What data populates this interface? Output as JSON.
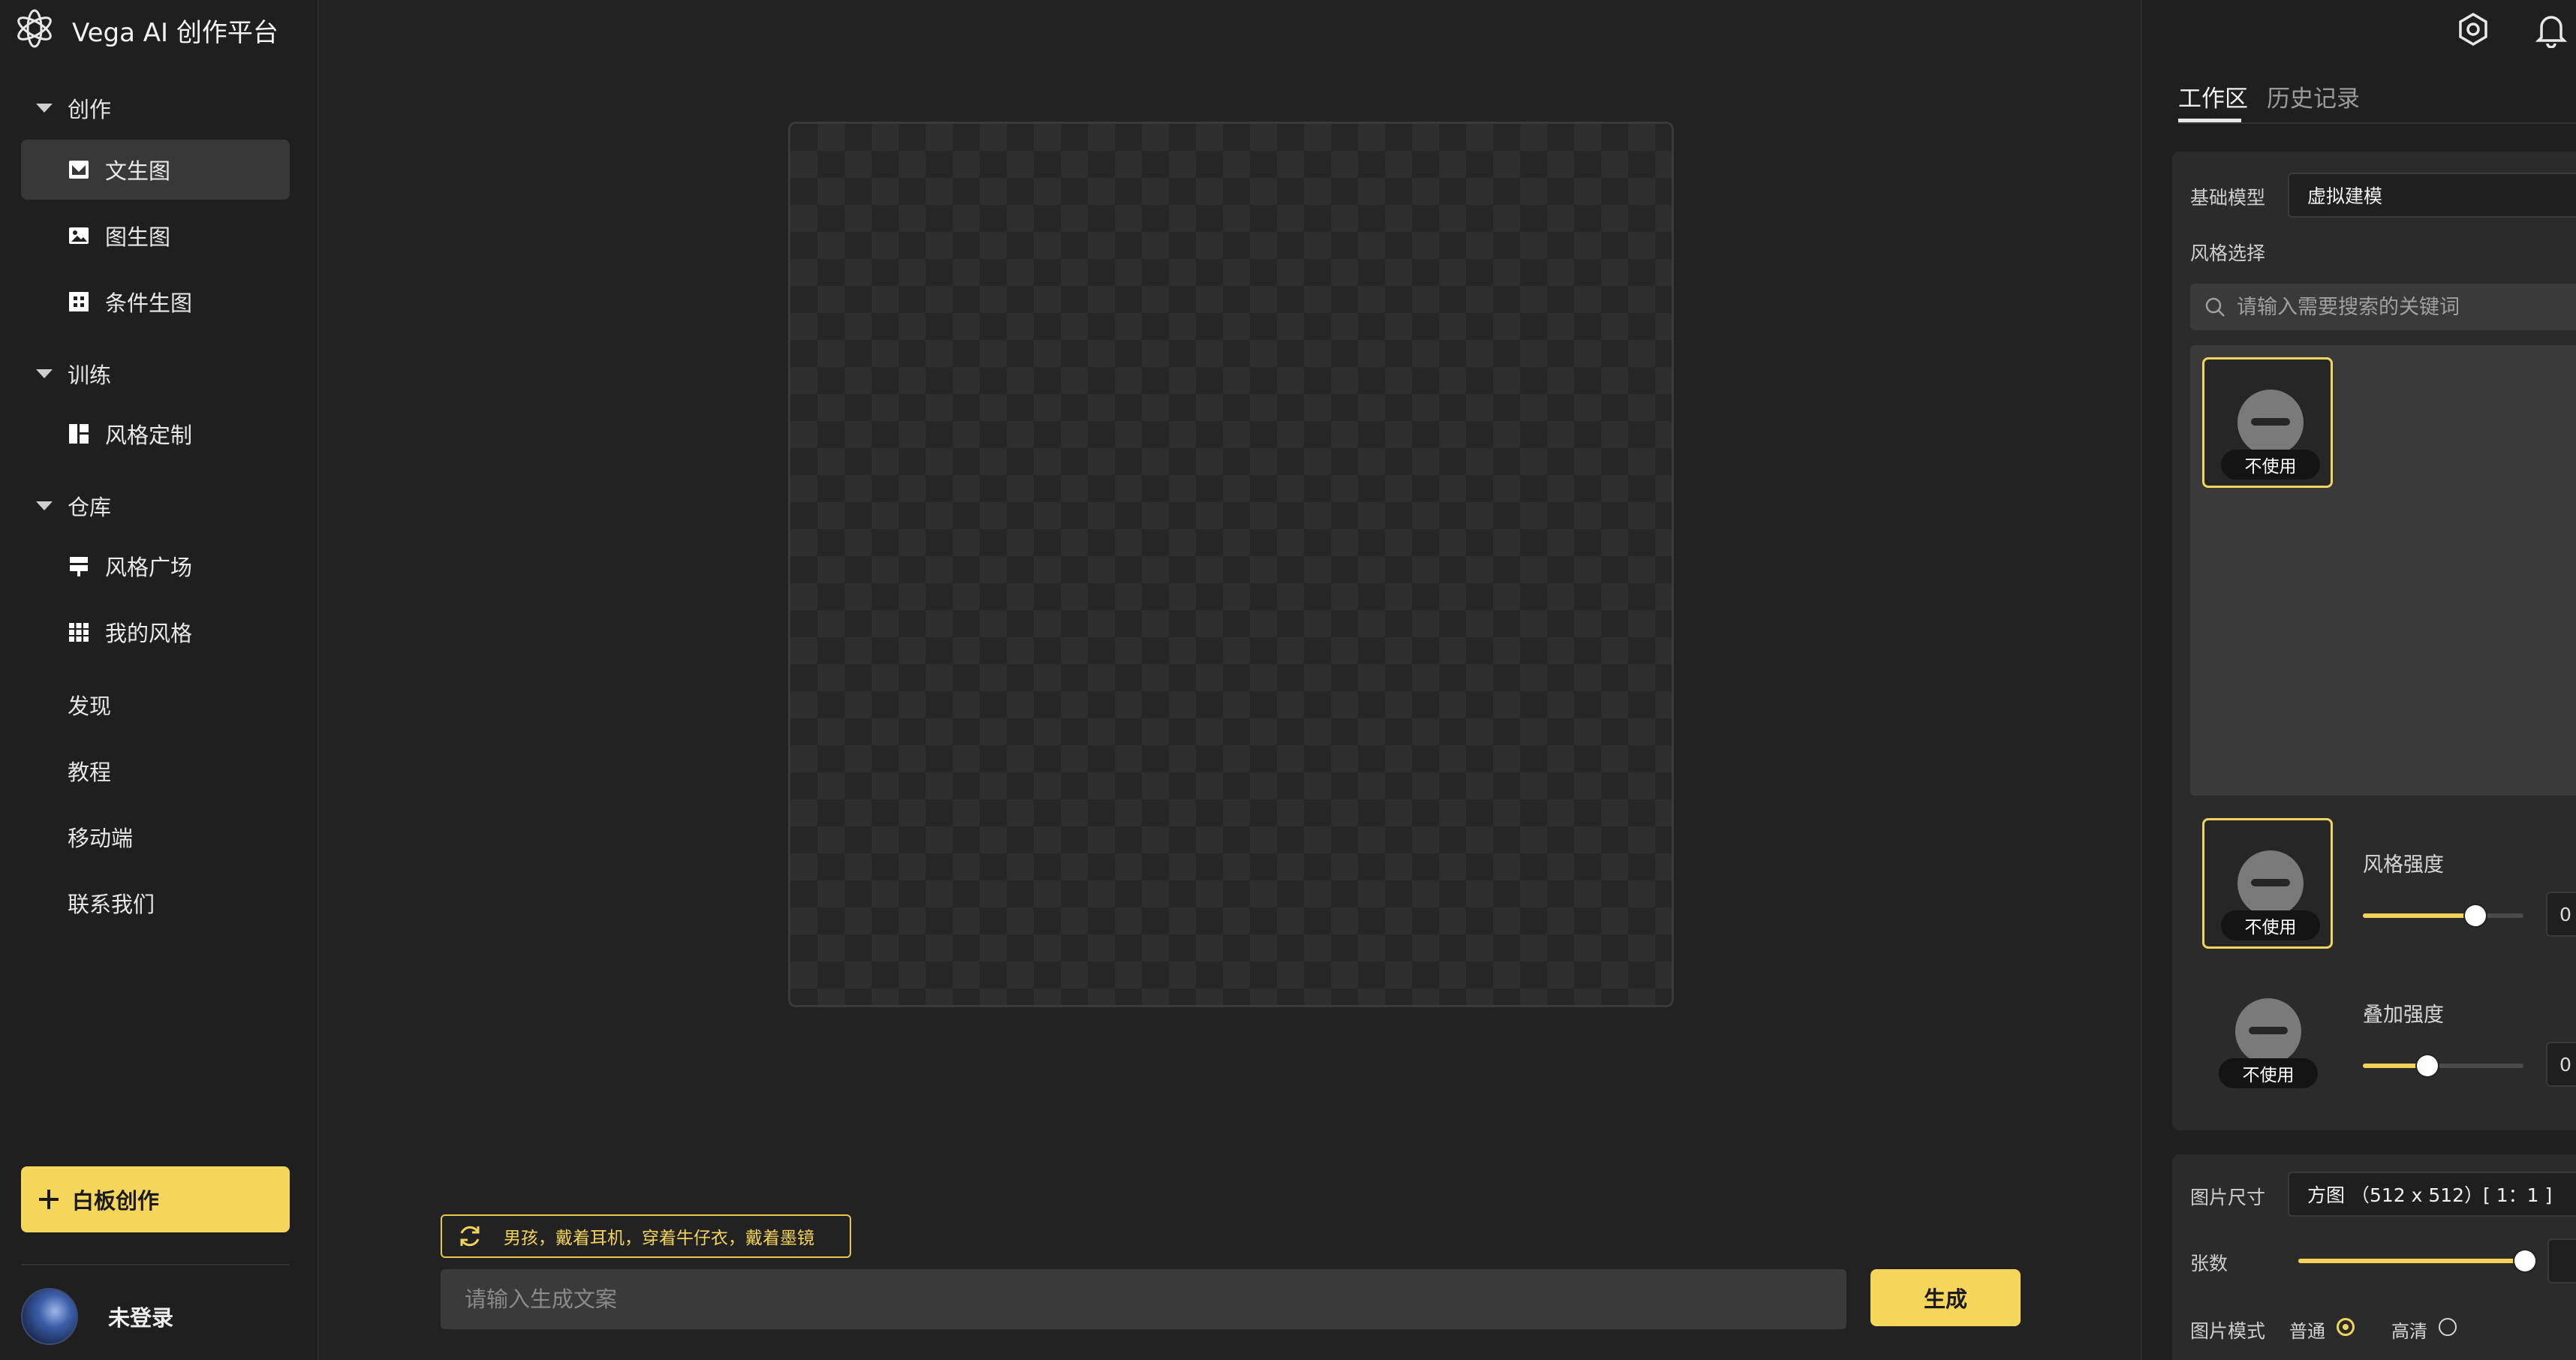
{
  "app": {
    "title": "Vega AI 创作平台"
  },
  "sidebar": {
    "groups": [
      {
        "label": "创作",
        "items": [
          {
            "label": "文生图"
          },
          {
            "label": "图生图"
          },
          {
            "label": "条件生图"
          }
        ]
      },
      {
        "label": "训练",
        "items": [
          {
            "label": "风格定制"
          }
        ]
      },
      {
        "label": "仓库",
        "items": [
          {
            "label": "风格广场"
          },
          {
            "label": "我的风格"
          }
        ]
      }
    ],
    "links": [
      {
        "label": "发现"
      },
      {
        "label": "教程"
      },
      {
        "label": "移动端"
      },
      {
        "label": "联系我们"
      }
    ],
    "whiteboard_label": "白板创作",
    "user_label": "未登录"
  },
  "main": {
    "prompt_suggestion": "男孩，戴着耳机，穿着牛仔衣，戴着墨镜",
    "prompt_placeholder": "请输入生成文案",
    "generate_label": "生成"
  },
  "right_panel": {
    "tabs": [
      {
        "label": "工作区"
      },
      {
        "label": "历史记录"
      }
    ],
    "base_model": {
      "label": "基础模型",
      "value": "虚拟建模"
    },
    "style_select": {
      "label": "风格选择",
      "search_placeholder": "请输入需要搜索的关键词"
    },
    "none_tag": "不使用",
    "style_strength": {
      "label": "风格强度",
      "value": 0.7,
      "readout": "0"
    },
    "overlay_strength": {
      "label": "叠加强度",
      "value": 0.4,
      "readout": "0"
    },
    "image_size": {
      "label": "图片尺寸",
      "value": "方图 （512 x 512）[ 1：1 ]"
    },
    "count": {
      "label": "张数",
      "value": 1.0
    },
    "image_mode": {
      "label": "图片模式",
      "options": [
        {
          "label": "普通",
          "selected": true
        },
        {
          "label": "高清",
          "selected": false
        }
      ]
    }
  },
  "colors": {
    "accent": "#f6d65a",
    "background": "#222222",
    "panel": "#2b2b2b"
  }
}
